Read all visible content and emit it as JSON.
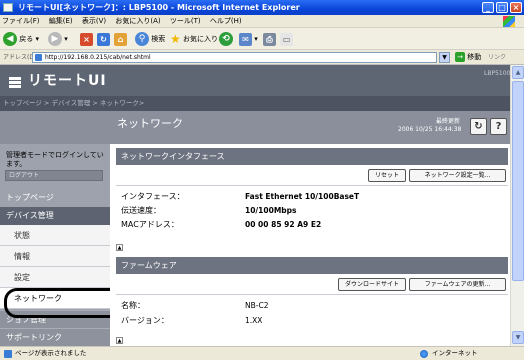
{
  "window": {
    "title": "リモートUI[ネットワーク]：: LBP5100 - Microsoft Internet Explorer",
    "controls": [
      "minimize-icon",
      "maximize-icon",
      "close-icon"
    ]
  },
  "menu": [
    "ファイル(F)",
    "編集(E)",
    "表示(V)",
    "お気に入り(A)",
    "ツール(T)",
    "ヘルプ(H)"
  ],
  "toolbar": {
    "back_label": "戻る",
    "search_label": "検索",
    "favorites_label": "お気に入り"
  },
  "address": {
    "label": "アドレス(D)",
    "url": "http://192.168.0.215/cab/net.shtml",
    "go_label": "移動",
    "links_label": "リンク"
  },
  "header": {
    "brand": "リモートUI",
    "model": "LBP5100",
    "breadcrumb": "トップページ > デバイス管理 > ネットワーク>"
  },
  "titlebar": {
    "page_title": "ネットワーク",
    "last_update_label": "最終更新",
    "last_update_time": "2006 10/25 16:44:38"
  },
  "sidebar": {
    "login_status": "管理者モードでログインしています。",
    "logout": "ログアウト",
    "items": [
      {
        "label": "トップページ"
      },
      {
        "label": "デバイス管理"
      },
      {
        "label": "状態"
      },
      {
        "label": "情報"
      },
      {
        "label": "設定"
      },
      {
        "label": "ネットワーク"
      },
      {
        "label": "ジョブ管理"
      },
      {
        "label": "サポートリンク"
      }
    ]
  },
  "sections": {
    "interface": {
      "title": "ネットワークインタフェース",
      "reset_button": "リセット",
      "settings_button": "ネットワーク設定一覧...",
      "rows": [
        {
          "label": "インタフェース：",
          "value": "Fast Ethernet 10/100BaseT"
        },
        {
          "label": "伝送速度：",
          "value": "10/100Mbps"
        },
        {
          "label": "MACアドレス：",
          "value": "00 00 85 92 A9 E2"
        }
      ]
    },
    "firmware": {
      "title": "ファームウェア",
      "download_button": "ダウンロードサイト",
      "update_button": "ファームウェアの更新...",
      "rows": [
        {
          "label": "名称：",
          "value": "NB-C2"
        },
        {
          "label": "バージョン：",
          "value": "1.XX"
        }
      ]
    }
  },
  "status": {
    "message": "ページが表示されました",
    "zone": "インターネット"
  }
}
